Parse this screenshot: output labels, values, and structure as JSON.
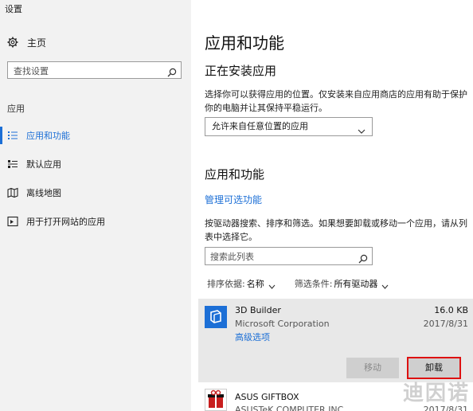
{
  "window": {
    "title": "设置"
  },
  "sidebar": {
    "home_label": "主页",
    "search_placeholder": "查找设置",
    "section_label": "应用",
    "items": [
      {
        "label": "应用和功能",
        "icon": "list-icon",
        "active": true
      },
      {
        "label": "默认应用",
        "icon": "default-apps-icon",
        "active": false
      },
      {
        "label": "离线地图",
        "icon": "map-icon",
        "active": false
      },
      {
        "label": "用于打开网站的应用",
        "icon": "web-app-icon",
        "active": false
      }
    ]
  },
  "main": {
    "title": "应用和功能",
    "install_section": {
      "heading": "正在安装应用",
      "description": "选择你可以获得应用的位置。仅安装来自应用商店的应用有助于保护你的电脑并让其保持平稳运行。",
      "dropdown_value": "允许来自任意位置的应用"
    },
    "apps_section": {
      "heading": "应用和功能",
      "manage_link": "管理可选功能",
      "description": "按驱动器搜索、排序和筛选。如果想要卸载或移动一个应用，请从列表中选择它。",
      "search_placeholder": "搜索此列表",
      "sort_label": "排序依据:",
      "sort_value": "名称",
      "filter_label": "筛选条件:",
      "filter_value": "所有驱动器"
    },
    "apps": [
      {
        "name": "3D Builder",
        "publisher": "Microsoft Corporation",
        "size": "16.0 KB",
        "date": "2017/8/31",
        "advanced_link": "高级选项",
        "move_label": "移动",
        "uninstall_label": "卸载",
        "icon_color": "#1c6fd6"
      },
      {
        "name": "ASUS GIFTBOX",
        "publisher": "ASUSTeK COMPUTER INC.",
        "size": "",
        "date": "2017/8/31"
      }
    ]
  },
  "watermark": "迪因诺",
  "colors": {
    "accent": "#1c6fd6",
    "highlight": "#dd1111"
  }
}
